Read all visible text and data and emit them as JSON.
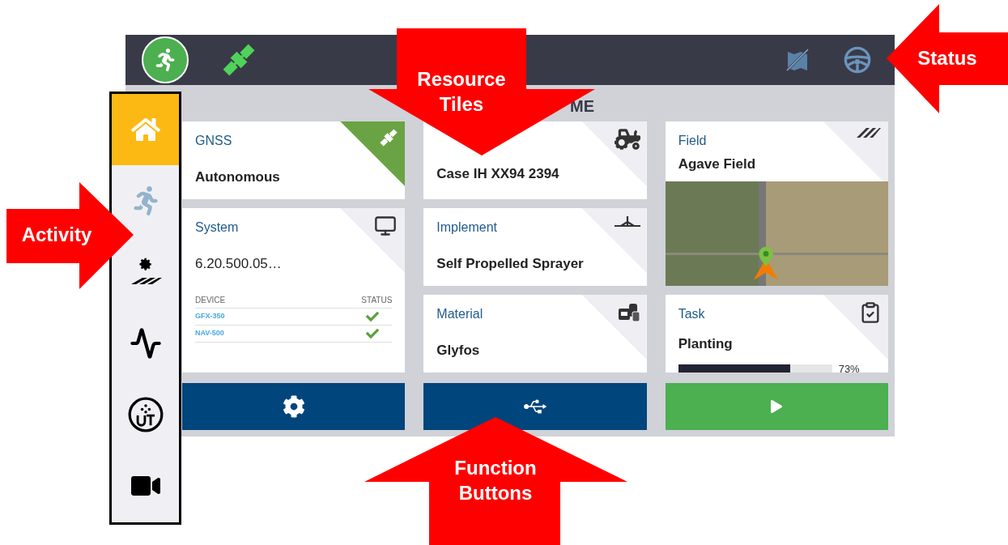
{
  "top_bar": {
    "activity_active": true
  },
  "sidebar": {
    "items": [
      {
        "kind": "home",
        "selected": true
      },
      {
        "kind": "activity",
        "selected": false
      },
      {
        "kind": "field-settings",
        "selected": false
      },
      {
        "kind": "diagnostics",
        "selected": false
      },
      {
        "kind": "ut",
        "selected": false
      },
      {
        "kind": "camera",
        "selected": false
      }
    ]
  },
  "header": {
    "title": "ME"
  },
  "tiles": [
    {
      "kind": "gnss",
      "label": "GNSS",
      "value": "Autonomous",
      "highlighted": true
    },
    {
      "kind": "vehicle",
      "value": "Case IH XX94 2394",
      "highlighted": false
    },
    {
      "kind": "field",
      "label": "Field",
      "value": "Agave Field",
      "highlighted": false
    },
    {
      "kind": "system",
      "label": "System",
      "value": "6.20.500.05…",
      "highlighted": false,
      "columns": [
        "DEVICE",
        "STATUS"
      ],
      "rows": [
        {
          "device": "GFX-350",
          "checked": true
        },
        {
          "device": "NAV-500",
          "checked": true
        }
      ]
    },
    {
      "kind": "implement",
      "label": "Implement",
      "value": "Self Propelled Sprayer",
      "highlighted": false
    },
    {
      "kind": "material",
      "label": "Material",
      "value": "Glyfos",
      "highlighted": false
    },
    {
      "kind": "task",
      "label": "Task",
      "value": "Planting",
      "level": 0.73,
      "reading": "73%",
      "highlighted": false
    }
  ],
  "function_buttons": [
    {
      "kind": "settings",
      "color": "#00457c"
    },
    {
      "kind": "usb",
      "color": "#00457c"
    },
    {
      "kind": "play",
      "color": "#4caf50"
    }
  ],
  "callouts": [
    {
      "kind": "down",
      "text": "Resource Tiles"
    },
    {
      "kind": "left",
      "text": "Status"
    },
    {
      "kind": "right",
      "text": "Activity"
    },
    {
      "kind": "up",
      "text": "Function Buttons"
    }
  ]
}
